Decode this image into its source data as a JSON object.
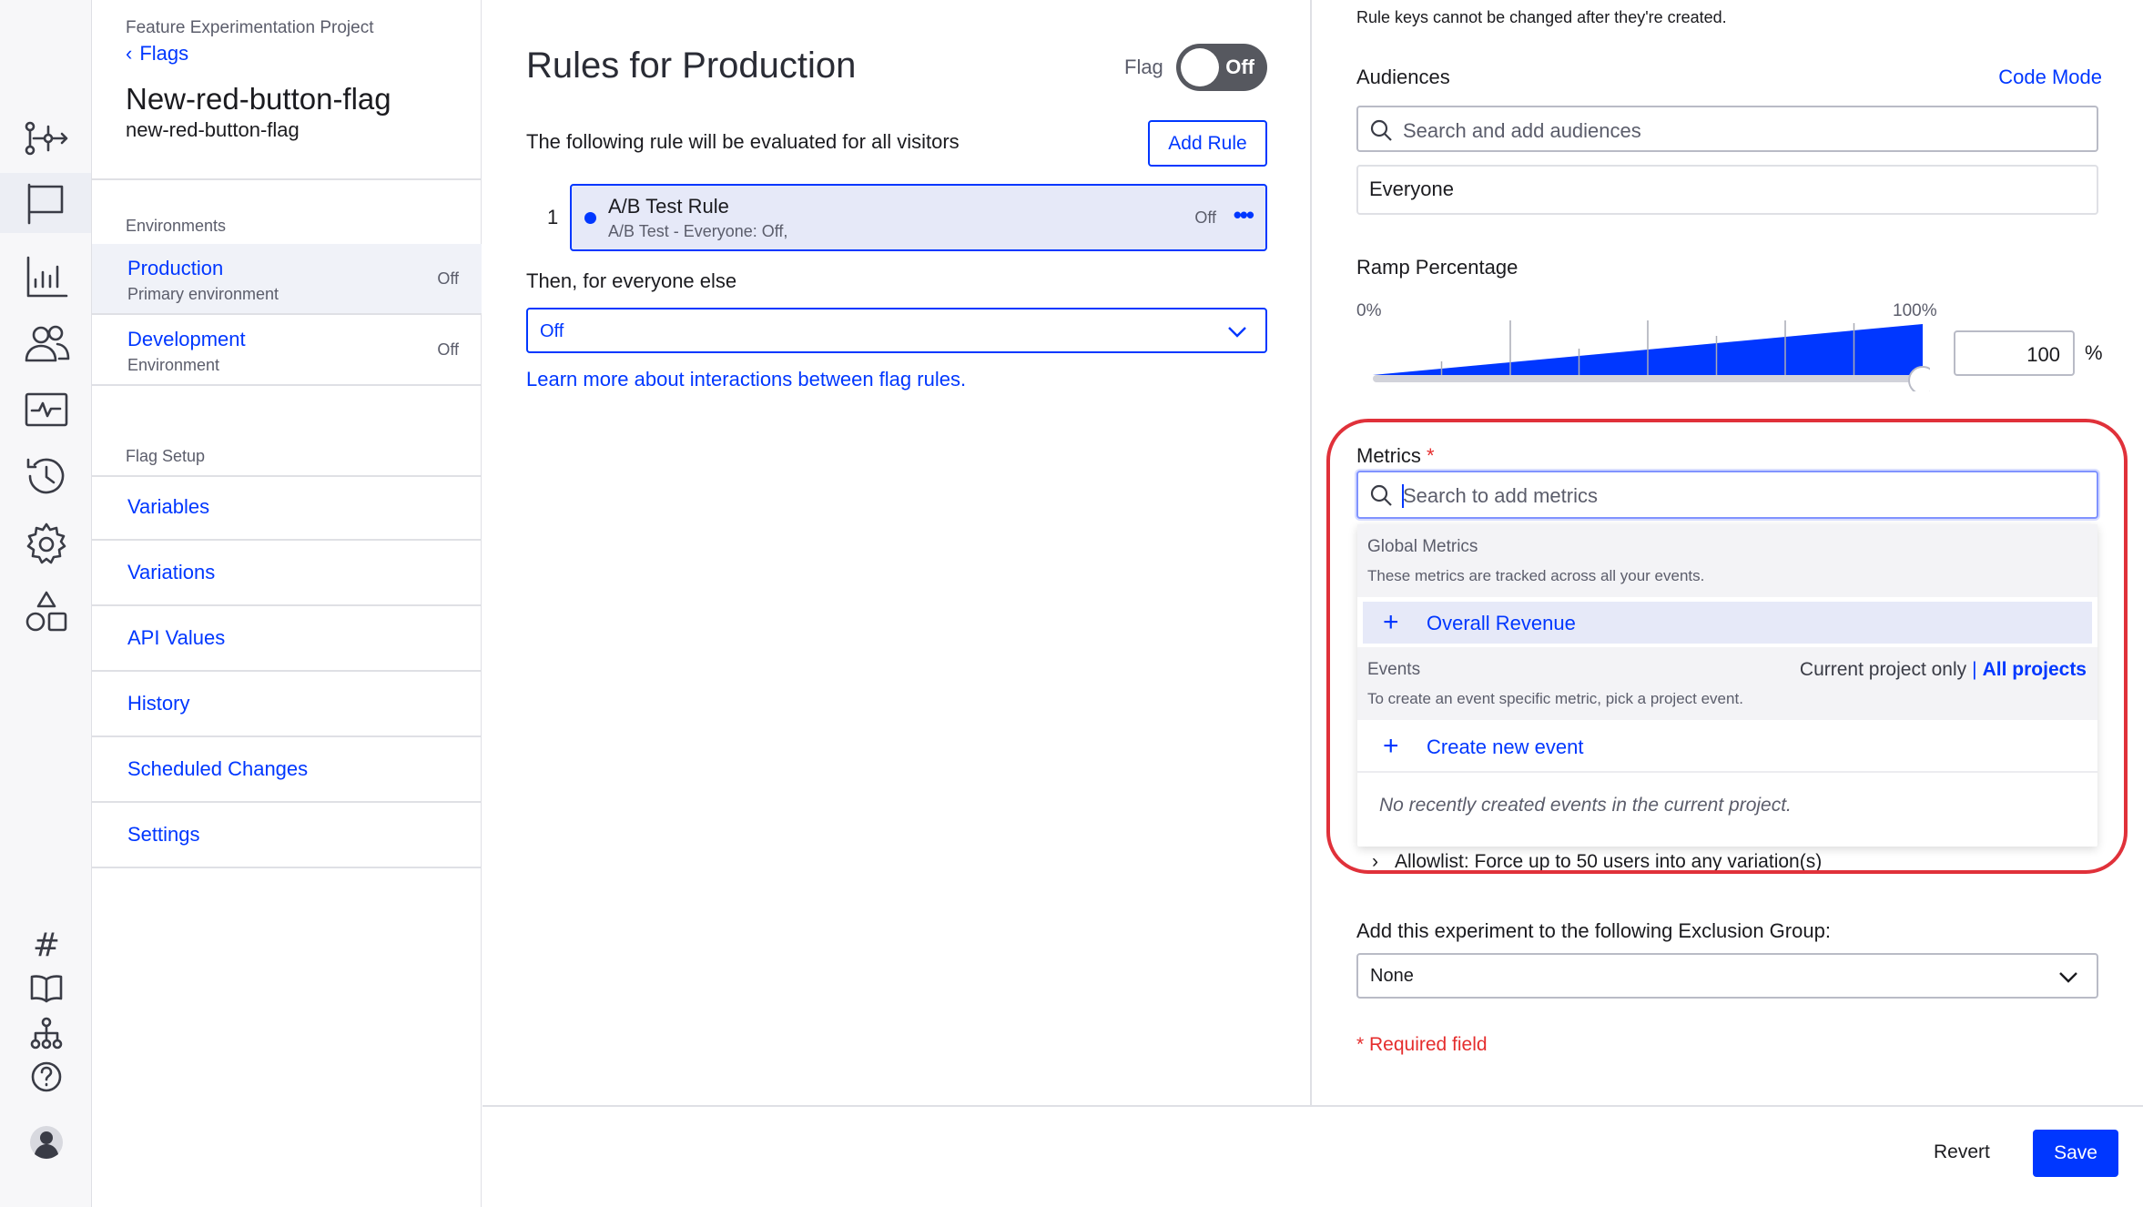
{
  "nav": {
    "project_name": "Feature Experimentation Project",
    "back_label": "Flags",
    "flag_name": "New-red-button-flag",
    "flag_key": "new-red-button-flag",
    "environments_label": "Environments",
    "environments": [
      {
        "name": "Production",
        "description": "Primary environment",
        "state": "Off"
      },
      {
        "name": "Development",
        "description": "Environment",
        "state": "Off"
      }
    ],
    "flag_setup_label": "Flag Setup",
    "setup_items": [
      "Variables",
      "Variations",
      "API Values",
      "History",
      "Scheduled Changes",
      "Settings"
    ]
  },
  "rules": {
    "title": "Rules for Production",
    "flag_label": "Flag",
    "flag_toggle": "Off",
    "intro": "The following rule will be evaluated for all visitors",
    "add_rule_label": "Add Rule",
    "rule": {
      "number": "1",
      "name": "A/B Test Rule",
      "summary": "A/B Test - Everyone: Off,",
      "state": "Off",
      "more": "•••"
    },
    "then_label": "Then, for everyone else",
    "fallback_value": "Off",
    "learn_more": "Learn more about interactions between flag rules."
  },
  "panel": {
    "note": "Rule keys cannot be changed after they're created.",
    "audiences_label": "Audiences",
    "code_mode": "Code Mode",
    "audience_placeholder": "Search and add audiences",
    "audience_value": "Everyone",
    "ramp_label": "Ramp Percentage",
    "ramp_min": "0%",
    "ramp_max": "100%",
    "ramp_value": "100",
    "ramp_unit": "%",
    "ramp_fraction": 1.0,
    "metrics_label": "Metrics",
    "required_star": "*",
    "metrics_placeholder": "Search to add metrics",
    "global_heading": "Global Metrics",
    "global_desc": "These metrics are tracked across all your events.",
    "global_item": "Overall Revenue",
    "events_heading": "Events",
    "scope_current": "Current project only",
    "scope_separator": "|",
    "scope_all": "All projects",
    "events_desc": "To create an event specific metric, pick a project event.",
    "create_event": "Create new event",
    "empty_events": "No recently created events in the current project.",
    "allowlist": "Allowlist: Force up to 50 users into any variation(s)",
    "exclusion_label": "Add this experiment to the following Exclusion Group:",
    "exclusion_value": "None",
    "required_note": "* Required field"
  },
  "footer": {
    "revert_label": "Revert",
    "save_label": "Save"
  },
  "colors": {
    "accent": "#0037ff",
    "error": "#e52d2d",
    "toggle_off": "#56585f"
  }
}
